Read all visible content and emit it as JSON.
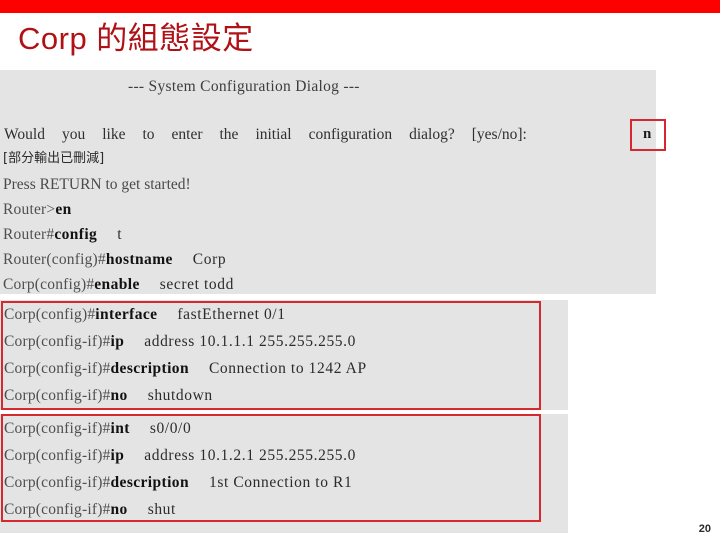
{
  "slide": {
    "title": "Corp 的組態設定",
    "page_number": "20",
    "accent_bar_color": "#fe0000",
    "title_color": "#b01116",
    "terminal_bg_color": "#e4e4e4",
    "highlight_box_color": "#d6282d"
  },
  "terminal": {
    "dialog_header": "---  System  Configuration  Dialog  ---",
    "question_words": [
      "Would",
      "you",
      "like",
      "to",
      "enter",
      "the",
      "initial",
      "configuration",
      "dialog?",
      "[yes/no]:"
    ],
    "question_full": "Would you like to enter the initial configuration dialog? [yes/no]:",
    "answer": "n",
    "omitted_note": "[部分輸出已刪減]",
    "press_return": "Press  RETURN  to  get  started!",
    "session_lines": [
      {
        "prompt": "Router>",
        "cmd": "en",
        "arg": ""
      },
      {
        "prompt": "Router#",
        "cmd": "config",
        "arg": "t"
      },
      {
        "prompt": "Router(config)#",
        "cmd": "hostname",
        "arg": "Corp"
      },
      {
        "prompt": "Corp(config)#",
        "cmd": "enable",
        "arg": "secret   todd"
      }
    ]
  },
  "block_fastethernet": {
    "lines": [
      {
        "prompt": "Corp(config)#",
        "cmd": "interface",
        "arg": "fastEthernet    0/1"
      },
      {
        "prompt": "Corp(config-if)#",
        "cmd": "ip",
        "arg": "address    10.1.1.1    255.255.255.0"
      },
      {
        "prompt": "Corp(config-if)#",
        "cmd": "description",
        "arg": "Connection  to  1242   AP"
      },
      {
        "prompt": "Corp(config-if)#",
        "cmd": "no",
        "arg": "shutdown"
      }
    ]
  },
  "block_serial": {
    "lines": [
      {
        "prompt": "Corp(config-if)#",
        "cmd": "int",
        "arg": "s0/0/0"
      },
      {
        "prompt": "Corp(config-if)#",
        "cmd": "ip",
        "arg": "address    10.1.2.1    255.255.255.0"
      },
      {
        "prompt": "Corp(config-if)#",
        "cmd": "description",
        "arg": "1st  Connection  to   R1"
      },
      {
        "prompt": "Corp(config-if)#",
        "cmd": "no",
        "arg": "shut"
      }
    ]
  }
}
